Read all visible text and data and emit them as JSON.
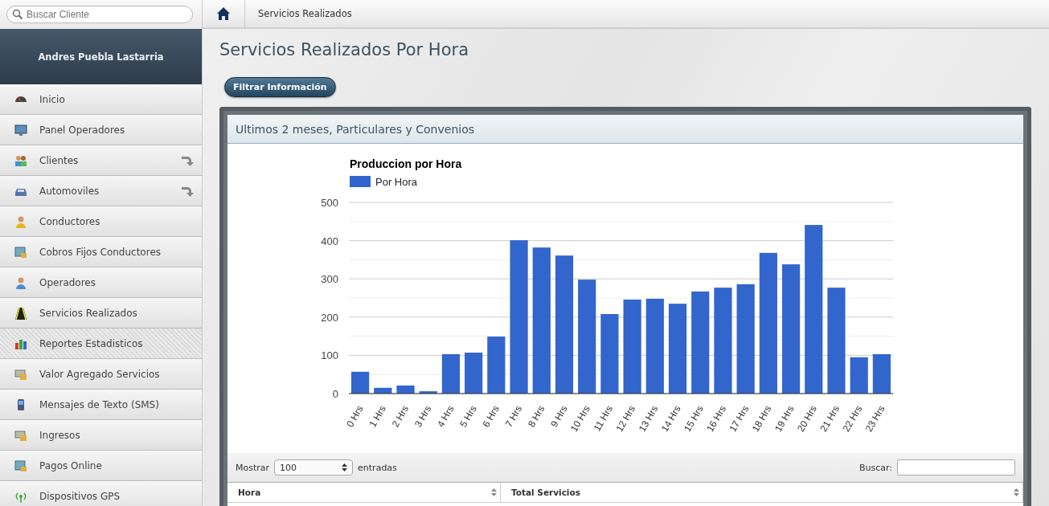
{
  "search": {
    "placeholder": "Buscar Cliente"
  },
  "breadcrumb": {
    "current": "Servicios Realizados"
  },
  "user": {
    "name": "Andres Puebla Lastarria"
  },
  "sidebar": {
    "items": [
      {
        "label": "Inicio",
        "expandable": false,
        "selected": false
      },
      {
        "label": "Panel Operadores",
        "expandable": false,
        "selected": false
      },
      {
        "label": "Clientes",
        "expandable": true,
        "selected": false
      },
      {
        "label": "Automoviles",
        "expandable": true,
        "selected": false
      },
      {
        "label": "Conductores",
        "expandable": false,
        "selected": false
      },
      {
        "label": "Cobros Fijos Conductores",
        "expandable": false,
        "selected": false
      },
      {
        "label": "Operadores",
        "expandable": false,
        "selected": false
      },
      {
        "label": "Servicios Realizados",
        "expandable": false,
        "selected": false
      },
      {
        "label": "Reportes Estadisticos",
        "expandable": false,
        "selected": true
      },
      {
        "label": "Valor Agregado Servicios",
        "expandable": false,
        "selected": false
      },
      {
        "label": "Mensajes de Texto (SMS)",
        "expandable": false,
        "selected": false
      },
      {
        "label": "Ingresos",
        "expandable": false,
        "selected": false
      },
      {
        "label": "Pagos Online",
        "expandable": false,
        "selected": false
      },
      {
        "label": "Dispositivos GPS",
        "expandable": false,
        "selected": false
      }
    ]
  },
  "page": {
    "title": "Servicios Realizados Por Hora",
    "filter_button": "Filtrar Información"
  },
  "panel": {
    "title": "Ultimos 2 meses, Particulares y Convenios",
    "chart_data": {
      "type": "bar",
      "title": "Produccion por Hora",
      "categories": [
        "0 Hrs",
        "1 Hrs",
        "2 Hrs",
        "3 Hrs",
        "4 Hrs",
        "5 Hrs",
        "6 Hrs",
        "7 Hrs",
        "8 Hrs",
        "9 Hrs",
        "10 Hrs",
        "11 Hrs",
        "12 Hrs",
        "13 Hrs",
        "14 Hrs",
        "15 Hrs",
        "16 Hrs",
        "17 Hrs",
        "18 Hrs",
        "19 Hrs",
        "20 Hrs",
        "21 Hrs",
        "22 Hrs",
        "23 Hrs"
      ],
      "series": [
        {
          "name": "Por Hora",
          "color": "#3366cc",
          "values": [
            57,
            15,
            21,
            6,
            103,
            107,
            149,
            401,
            382,
            361,
            298,
            208,
            246,
            248,
            235,
            267,
            277,
            286,
            368,
            338,
            441,
            277,
            95,
            103
          ]
        }
      ],
      "ylim": [
        0,
        500
      ],
      "grid": true,
      "yticks": [
        0,
        100,
        200,
        300,
        400,
        500
      ]
    },
    "table": {
      "show_label": "Mostrar",
      "page_size": "100",
      "entries_label": "entradas",
      "search_label": "Buscar:",
      "columns": [
        "Hora",
        "Total Servicios"
      ]
    }
  }
}
